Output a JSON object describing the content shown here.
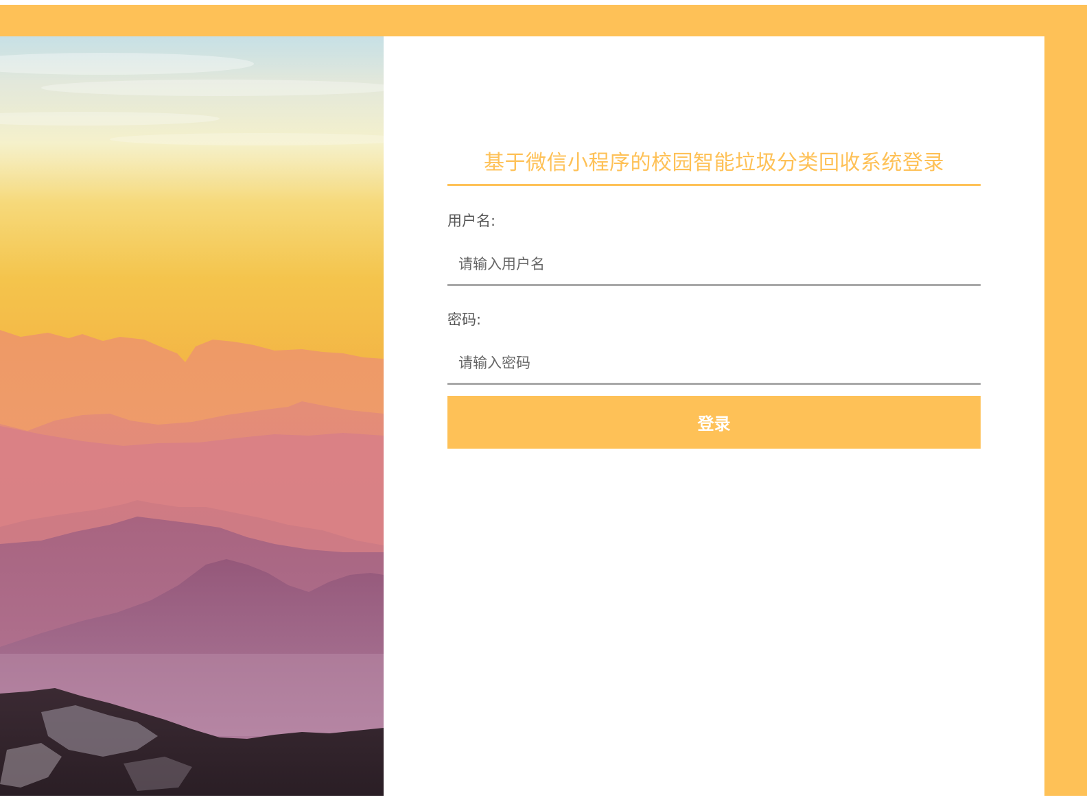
{
  "brand": {
    "accent_color": "#FEC157",
    "input_border_color": "#A8A8A8"
  },
  "login": {
    "title": "基于微信小程序的校园智能垃圾分类回收系统登录",
    "username": {
      "label": "用户名:",
      "placeholder": "请输入用户名",
      "value": ""
    },
    "password": {
      "label": "密码:",
      "placeholder": "请输入密码",
      "value": ""
    },
    "submit_label": "登录"
  },
  "background_image": {
    "subject": "sunset-mountain-ranges"
  }
}
